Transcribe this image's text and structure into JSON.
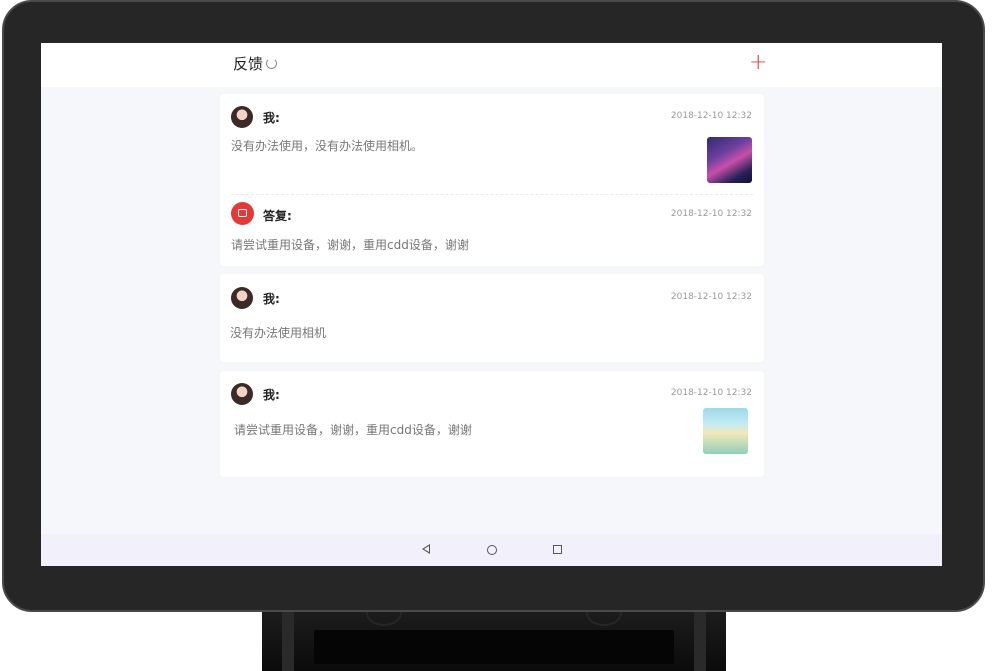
{
  "header": {
    "title": "反馈",
    "refresh_icon": "refresh-icon",
    "add_icon": "plus-icon",
    "accent_color": "#e53935"
  },
  "feedback": [
    {
      "user_label": "我:",
      "time": "2018-12-10 12:32",
      "message": "没有办法使用，没有办法使用相机。",
      "has_image": true,
      "reply": {
        "label": "答复:",
        "time": "2018-12-10 12:32",
        "message": "请尝试重用设备，谢谢，重用cdd设备，谢谢"
      }
    },
    {
      "user_label": "我:",
      "time": "2018-12-10 12:32",
      "message": "没有办法使用相机",
      "has_image": false
    },
    {
      "user_label": "我:",
      "time": "2018-12-10 12:32",
      "message": "请尝试重用设备，谢谢，重用cdd设备，谢谢",
      "has_image": true
    }
  ],
  "navbar": {
    "back_icon": "back-triangle-icon",
    "home_icon": "home-circle-icon",
    "recents_icon": "recents-square-icon"
  }
}
